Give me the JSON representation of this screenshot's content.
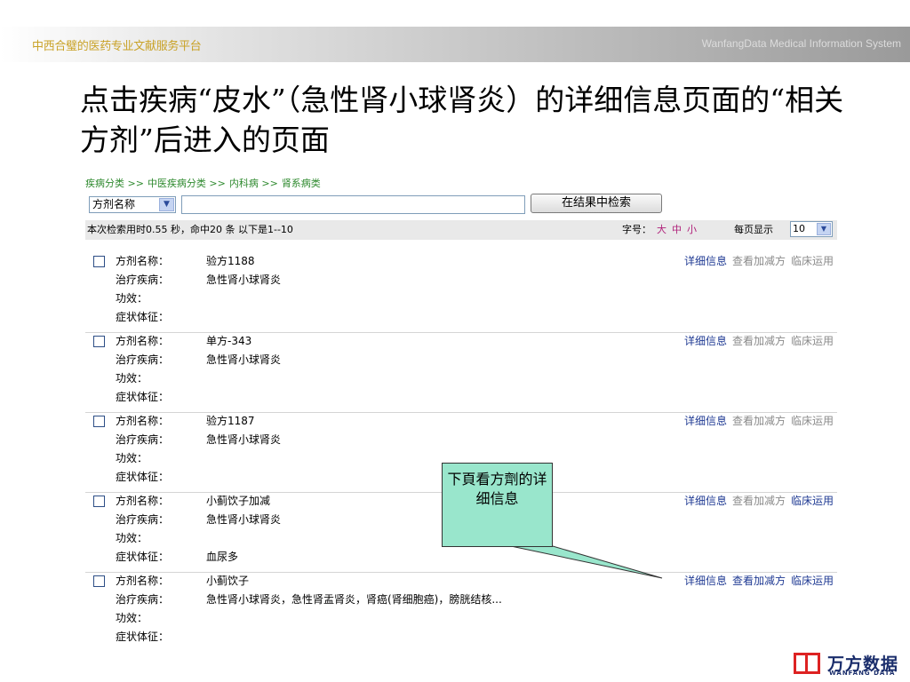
{
  "header": {
    "platform_cn": "中西合璧的医药专业文献服务平台",
    "platform_en": "WanfangData Medical Information System"
  },
  "slide": {
    "title": "点击疾病“皮水”（急性肾小球肾炎）的详细信息页面的“相关方剂”后进入的页面"
  },
  "breadcrumb": [
    "疾病分类 >>",
    "中医疾病分类 >>",
    "内科病 >>",
    "肾系病类"
  ],
  "search": {
    "field_selected": "方剂名称",
    "input_value": "",
    "button_label": "在结果中检索"
  },
  "status": {
    "summary": "本次检索用时0.55 秒，命中20 条 以下是1--10",
    "font_label": "字号：",
    "font_large": "大",
    "font_medium": "中",
    "font_small": "小",
    "per_page_label": "每页显示",
    "per_page_value": "10"
  },
  "labels": {
    "name": "方剂名称：",
    "disease": "治疗疾病：",
    "effect": "功效：",
    "symptom": "症状体征："
  },
  "actions": {
    "detail": "详细信息",
    "modify": "查看加减方",
    "clinical": "临床运用"
  },
  "results": [
    {
      "name": "验方1188",
      "disease": "急性肾小球肾炎",
      "effect": "",
      "symptom": ""
    },
    {
      "name": "单方-343",
      "disease": "急性肾小球肾炎",
      "effect": "",
      "symptom": ""
    },
    {
      "name": "验方1187",
      "disease": "急性肾小球肾炎",
      "effect": "",
      "symptom": ""
    },
    {
      "name": "小蓟饮子加减",
      "disease": "急性肾小球肾炎",
      "effect": "",
      "symptom": "血尿多"
    },
    {
      "name": "小蓟饮子",
      "disease": "急性肾小球肾炎，急性肾盂肾炎，肾癌(肾细胞癌)，膀胱结核...",
      "effect": "",
      "symptom": ""
    }
  ],
  "callout": {
    "text": "下頁看方劑的详细信息"
  },
  "logo": {
    "cn": "万方数据",
    "en": "WANFANG DATA"
  },
  "colors": {
    "breadcrumb": "#2f8a2f",
    "link_blue": "#1f3a93",
    "link_gray": "#8a8a8a",
    "font_option": "#b0207a",
    "callout_fill": "#99e6cc",
    "logo_red": "#dd2222"
  }
}
